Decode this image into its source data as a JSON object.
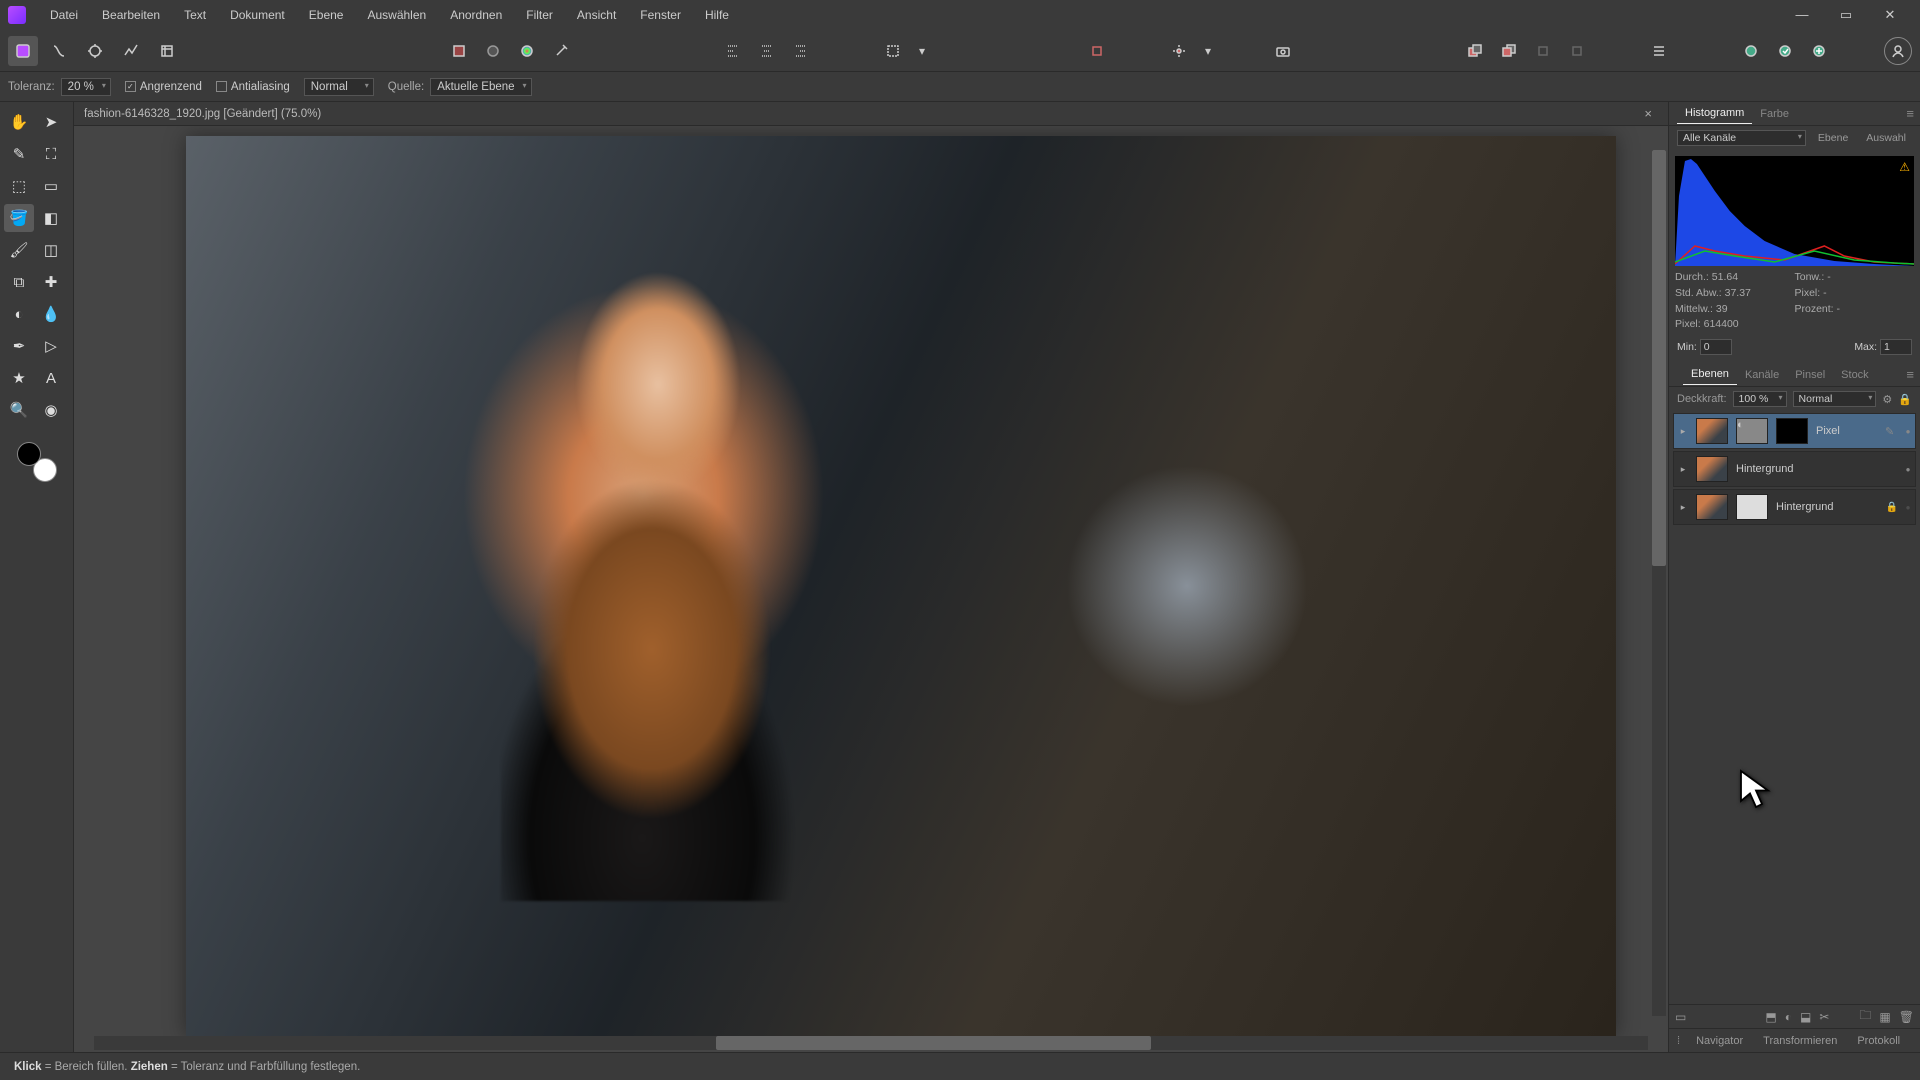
{
  "menu": [
    "Datei",
    "Bearbeiten",
    "Text",
    "Dokument",
    "Ebene",
    "Auswählen",
    "Anordnen",
    "Filter",
    "Ansicht",
    "Fenster",
    "Hilfe"
  ],
  "context": {
    "tolerance_label": "Toleranz:",
    "tolerance_value": "20 %",
    "contiguous": "Angrenzend",
    "antialias": "Antialiasing",
    "blend_mode": "Normal",
    "source_label": "Quelle:",
    "source_value": "Aktuelle Ebene"
  },
  "document": {
    "tab_title": "fashion-6146328_1920.jpg [Geändert] (75.0%)"
  },
  "histogram": {
    "tabs": [
      "Histogramm",
      "Farbe"
    ],
    "channel": "Alle Kanäle",
    "buttons": [
      "Ebene",
      "Auswahl"
    ],
    "stats": {
      "mean_label": "Durch.:",
      "mean_val": "51.64",
      "std_label": "Std. Abw.:",
      "std_val": "37.37",
      "median_label": "Mittelw.:",
      "median_val": "39",
      "pixels_label": "Pixel:",
      "pixels_val": "614400",
      "tone_label": "Tonw.:",
      "tone_val": "-",
      "pix_label": "Pixel:",
      "pix_val": "-",
      "pct_label": "Prozent:",
      "pct_val": "-"
    },
    "min_label": "Min:",
    "min_val": "0",
    "max_label": "Max:",
    "max_val": "1"
  },
  "layers_panel": {
    "tabs": [
      "Ebenen",
      "Kanäle",
      "Pinsel",
      "Stock"
    ],
    "opacity_label": "Deckkraft:",
    "opacity_value": "100 %",
    "blend_mode": "Normal",
    "layers": [
      {
        "name": "Pixel",
        "type": "pixel",
        "selected": true
      },
      {
        "name": "Hintergrund",
        "type": "bg",
        "selected": false
      },
      {
        "name": "Hintergrund",
        "type": "locked",
        "selected": false
      }
    ]
  },
  "bottom_tabs": [
    "Navigator",
    "Transformieren",
    "Protokoll"
  ],
  "status": {
    "click_label": "Klick",
    "click_desc": " = Bereich füllen. ",
    "drag_label": "Ziehen",
    "drag_desc": " = Toleranz und Farbfüllung festlegen."
  }
}
